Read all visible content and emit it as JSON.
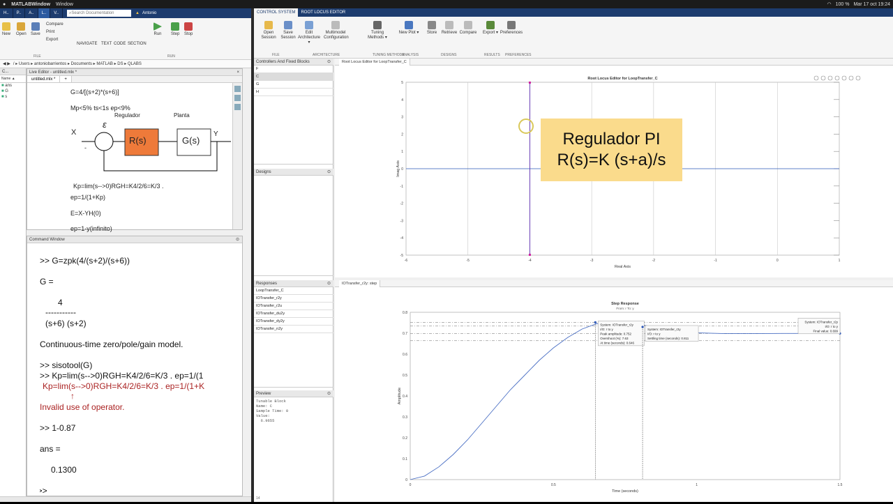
{
  "menubar": {
    "app": "MATLABWindow",
    "window": "Window",
    "battery": "100 %",
    "datetime": "Mar 17 oct 19:24"
  },
  "matlab": {
    "tabs": [
      "H..",
      "P..",
      "A..",
      "L..",
      "V.."
    ],
    "search_placeholder": "Search Documentation",
    "user": "Antonio",
    "toolbar": {
      "new": "New",
      "open": "Open",
      "save": "Save",
      "compare": "Compare",
      "print": "Print",
      "export": "Export",
      "navigate": "NAVIGATE",
      "text": "TEXT",
      "code": "CODE",
      "section": "SECTION",
      "run": "Run",
      "step": "Step",
      "stop": "Stop",
      "file_group": "FILE",
      "run_group": "RUN"
    },
    "path": "/ ▸ Users ▸ antoniobarrientos ▸ Documents ▸ MATLAB ▸ DS ▸ QLABS",
    "current_folder": {
      "header": "C...",
      "name_col": "Name ▲",
      "items": [
        "ans",
        "G",
        "s"
      ]
    },
    "live_editor": {
      "title": "Live Editor - untitled.mlx *",
      "tab": "untitled.mlx *",
      "lines": [
        "G=4/[(s+2)*(s+6)]",
        "Mp<5%    ts<1s     ep<9%",
        "Kp=lim(s-->0)RGH=K4/2/6=K/3 .",
        "ep=1/(1+Kp)",
        "E=X-YH(0)",
        "ep=1-y(infinito)"
      ],
      "diagram": {
        "x": "X",
        "y": "Y",
        "eps": "ε",
        "minus": "-",
        "reg_label": "Regulador",
        "reg": "R(s)",
        "plant_label": "Planta",
        "plant": "G(s)"
      }
    },
    "command_window": {
      "title": "Command Window",
      "lines": [
        ">> G=zpk(4/(s+2)/(s+6))",
        "G =",
        "4",
        "-----------",
        "(s+6) (s+2)",
        "Continuous-time zero/pole/gain model.",
        ">> sisotool(G)",
        ">> Kp=lim(s-->0)RGH=K4/2/6=K/3 .  ep=1/(1",
        "Kp=lim(s-->0)RGH=K4/2/6=K/3 .  ep=1/(1+K",
        "↑",
        "Invalid use of operator.",
        ">> 1-0.87",
        "ans =",
        "0.1300"
      ],
      "prompt": "fx >>"
    }
  },
  "siso": {
    "tabs": [
      "CONTROL SYSTEM",
      "ROOT LOCUS EDITOR"
    ],
    "toolbar": [
      {
        "label": "Open Session",
        "color": "#e7b94b"
      },
      {
        "label": "Save Session",
        "color": "#6a8fc8"
      },
      {
        "label": "Edit Architecture ▾",
        "color": "#7aa0d4"
      },
      {
        "label": "Multimodel Configuration",
        "color": "#bbbbbb"
      },
      {
        "label": "Tuning Methods ▾",
        "color": "#666666"
      },
      {
        "label": "New Plot ▾",
        "color": "#4a78c0"
      },
      {
        "label": "Store",
        "color": "#888888"
      },
      {
        "label": "Retrieve",
        "color": "#bbbbbb"
      },
      {
        "label": "Compare",
        "color": "#bbbbbb"
      },
      {
        "label": "Export ▾",
        "color": "#5a8a3a"
      },
      {
        "label": "Preferences",
        "color": "#777777"
      }
    ],
    "groups": [
      "FILE",
      "ARCHITECTURE",
      "TUNING METHODS",
      "ANALYSIS",
      "DESIGNS",
      "RESULTS",
      "PREFERENCES"
    ],
    "controllers": {
      "title": "Controllers And Fixed Blocks",
      "items": [
        "F",
        "C",
        "G",
        "H"
      ],
      "selected": "C"
    },
    "designs": {
      "title": "Designs"
    },
    "responses": {
      "title": "Responses",
      "items": [
        "LoopTransfer_C",
        "IOTransfer_r2y",
        "IOTransfer_r2u",
        "IOTransfer_du2y",
        "IOTransfer_dy2y",
        "IOTransfer_n2y"
      ]
    },
    "preview": {
      "title": "Preview",
      "lines": [
        "Tunable Block",
        "Name: C",
        "Sample Time: 0",
        "Value:",
        "  6.9655"
      ]
    },
    "rl_tab": "Root Locus Editor for LoopTransfer_C",
    "step_tab": "IOTransfer_r2y: step",
    "status": "14",
    "annotation": [
      "Regulador PI",
      "R(s)=K (s+a)/s"
    ]
  },
  "chart_data": [
    {
      "type": "scatter",
      "title": "Root Locus Editor for LoopTransfer_C",
      "xlabel": "Real Axis",
      "ylabel": "Imag Axis",
      "xlim": [
        -6,
        1
      ],
      "ylim": [
        -5,
        5
      ],
      "xticks": [
        -6,
        -5,
        -4,
        -3,
        -2,
        -1,
        0,
        1
      ],
      "yticks": [
        -5,
        -4,
        -3,
        -2,
        -1,
        0,
        1,
        2,
        3,
        4,
        5
      ],
      "locus": [
        {
          "x": -4,
          "y_from": -5,
          "y_to": 5
        },
        {
          "x_from": -6,
          "x_to": 1,
          "y": 0
        }
      ],
      "closed_loop_poles": [
        {
          "x": -4,
          "y": 4.98
        },
        {
          "x": -4,
          "y": -4.98
        }
      ]
    },
    {
      "type": "line",
      "title": "Step Response",
      "subtitle": "From: r  To: y",
      "xlabel": "Time (seconds)",
      "ylabel": "Amplitude",
      "xlim": [
        0,
        1.5
      ],
      "ylim": [
        0,
        0.8
      ],
      "xticks": [
        0,
        0.5,
        1,
        1.5
      ],
      "yticks": [
        0,
        0.1,
        0.2,
        0.3,
        0.4,
        0.5,
        0.6,
        0.7,
        0.8
      ],
      "x": [
        0,
        0.05,
        0.1,
        0.15,
        0.2,
        0.25,
        0.3,
        0.35,
        0.4,
        0.45,
        0.5,
        0.55,
        0.6,
        0.65,
        0.7,
        0.75,
        0.8,
        0.85,
        0.9,
        0.95,
        1.0,
        1.1,
        1.2,
        1.3,
        1.4,
        1.5
      ],
      "y": [
        0,
        0.017,
        0.061,
        0.12,
        0.19,
        0.27,
        0.35,
        0.43,
        0.5,
        0.57,
        0.63,
        0.68,
        0.72,
        0.745,
        0.752,
        0.75,
        0.742,
        0.73,
        0.718,
        0.708,
        0.702,
        0.698,
        0.698,
        0.699,
        0.699,
        0.699
      ],
      "datatips": [
        {
          "t": 0.646,
          "y": 0.752,
          "lines": [
            "System: IOTransfer_r2y",
            "I/O: r to y",
            "Peak amplitude: 0.752",
            "Overshoot (%): 7.63",
            "At time (seconds): 0.646"
          ]
        },
        {
          "t": 0.811,
          "y": 0.73,
          "lines": [
            "System: IOTransfer_r2y",
            "I/O: r to y",
            "Settling time (seconds): 0.811"
          ]
        },
        {
          "t": 1.5,
          "y": 0.699,
          "lines": [
            "System: IOTransfer_r2y",
            "I/O: r to y",
            "Final value: 0.699"
          ]
        }
      ],
      "hlines": [
        0.752,
        0.734,
        0.699,
        0.664
      ]
    }
  ]
}
